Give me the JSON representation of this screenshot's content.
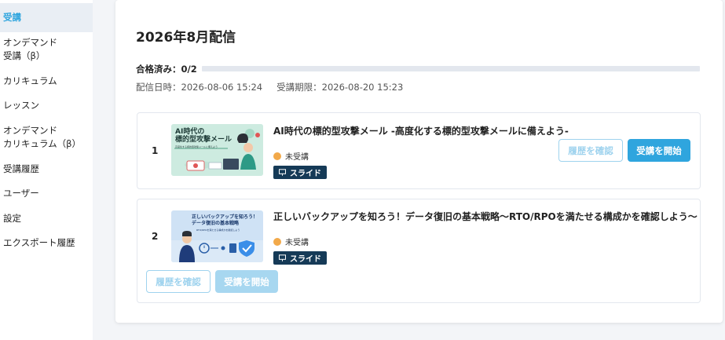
{
  "sidebar": {
    "items": [
      {
        "label": "受講",
        "active": true
      },
      {
        "label": "オンデマンド\n受講（β）"
      },
      {
        "label": "カリキュラム"
      },
      {
        "label": "レッスン"
      },
      {
        "label": "オンデマンド\nカリキュラム（β）"
      },
      {
        "label": "受講履歴"
      },
      {
        "label": "ユーザー"
      },
      {
        "label": "設定"
      },
      {
        "label": "エクスポート履歴"
      }
    ]
  },
  "main": {
    "title": "2026年8月配信",
    "progress": {
      "label": "合格済み：0/2",
      "passed": 0,
      "total": 2
    },
    "delivery_date": "配信日時：2026-08-06 15:24",
    "deadline": "受講期限：2026-08-20 15:23",
    "lessons": [
      {
        "number": "1",
        "title": "AI時代の標的型攻撃メール -高度化する標的型攻撃メールに備えよう-",
        "status": "未受講",
        "type": "スライド",
        "thumb_title": "AI時代の\n標的型攻撃メール",
        "thumb_sub": "高度化する標的型攻撃メールに備えよう",
        "history_button": "履歴を確認",
        "start_button": "受講を開始"
      },
      {
        "number": "2",
        "title": "正しいバックアップを知ろう！データ復旧の基本戦略〜RTO/RPOを満たせる構成かを確認しよう〜",
        "status": "未受講",
        "type": "スライド",
        "thumb_title": "正しいバックアップを知ろう！\nデータ復旧の基本戦略",
        "thumb_sub": "RTO/RPOを満たせる構成かを確認しよう",
        "history_button": "履歴を確認",
        "start_button": "受講を開始"
      }
    ]
  },
  "colors": {
    "accent": "#2fa5de",
    "status_not_started": "#f2a94a",
    "badge_bg": "#153a57"
  },
  "icons": {
    "slide_badge": "presentation-icon"
  }
}
